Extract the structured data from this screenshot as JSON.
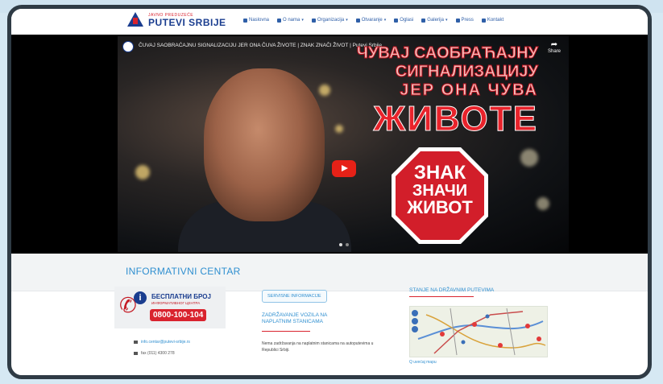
{
  "site": {
    "logo_subtitle": "JAVNO PREDUZEĆE",
    "logo_name": "PUTEVI SRBIJE"
  },
  "nav": {
    "items": [
      {
        "label": "Naslovna",
        "icon": "home-icon",
        "dropdown": false
      },
      {
        "label": "O nama",
        "icon": "users-icon",
        "dropdown": true
      },
      {
        "label": "Organizacija",
        "icon": "sitemap-icon",
        "dropdown": true
      },
      {
        "label": "Otvaranje",
        "icon": "folder-icon",
        "dropdown": true
      },
      {
        "label": "Oglasi",
        "icon": "megaphone-icon",
        "dropdown": false
      },
      {
        "label": "Galerija",
        "icon": "camera-icon",
        "dropdown": true
      },
      {
        "label": "Press",
        "icon": "news-icon",
        "dropdown": false
      },
      {
        "label": "Kontakt",
        "icon": "contact-icon",
        "dropdown": false
      }
    ]
  },
  "video": {
    "title": "ČUVAJ SAOBRAĆAJNU SIGNALIZACIJU JER ONA ČUVA ŽIVOTE | ZNAK ZNAČI ŽIVOT | Putevi Srbije",
    "share_label": "Share",
    "overlay_lines": [
      "ЧУВАЈ САОБРАЋАЈНУ",
      "СИГНАЛИЗАЦИЈУ",
      "ЈЕР ОНА ЧУВА",
      "ЖИВОТЕ"
    ],
    "stop_sign_lines": [
      "ЗНАК",
      "ЗНАЧИ",
      "ЖИВОТ"
    ]
  },
  "info": {
    "section_title": "INFORMATIVNI CENTAR",
    "hotline": {
      "line1": "БЕСПЛАТНИ БРОЈ",
      "line2": "ИНФОРМАТИВНОГ ЦЕНТРА",
      "number": "0800-100-104"
    },
    "contacts": {
      "email": "info.centar@putevi-srbije.rs",
      "fax": "fax (011) 4300 278"
    },
    "service_button": "SERVISNE INFORMACIJE",
    "news_title": "ZADRŽAVANJE VOZILA NA NAPLATNIM STANICAMA",
    "news_text": "Nema zadržavanja na naplatnim stanicama na autoputevima u Republici Srbiji.",
    "roads_title": "STANJE NA DRŽAVNIM PUTEVIMA",
    "map_link": "Q uvećaj mapu"
  },
  "colors": {
    "brand_blue": "#1a3d8f",
    "accent_blue": "#2f8fd0",
    "brand_red": "#d9232e",
    "frame": "#2f3b45"
  }
}
